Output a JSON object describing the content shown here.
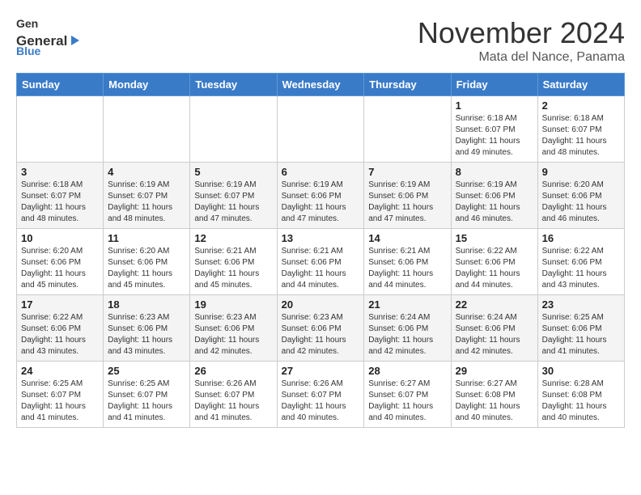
{
  "logo": {
    "text_general": "General",
    "text_blue": "Blue"
  },
  "header": {
    "month": "November 2024",
    "location": "Mata del Nance, Panama"
  },
  "weekdays": [
    "Sunday",
    "Monday",
    "Tuesday",
    "Wednesday",
    "Thursday",
    "Friday",
    "Saturday"
  ],
  "weeks": [
    [
      {
        "day": "",
        "info": ""
      },
      {
        "day": "",
        "info": ""
      },
      {
        "day": "",
        "info": ""
      },
      {
        "day": "",
        "info": ""
      },
      {
        "day": "",
        "info": ""
      },
      {
        "day": "1",
        "info": "Sunrise: 6:18 AM\nSunset: 6:07 PM\nDaylight: 11 hours and 49 minutes."
      },
      {
        "day": "2",
        "info": "Sunrise: 6:18 AM\nSunset: 6:07 PM\nDaylight: 11 hours and 48 minutes."
      }
    ],
    [
      {
        "day": "3",
        "info": "Sunrise: 6:18 AM\nSunset: 6:07 PM\nDaylight: 11 hours and 48 minutes."
      },
      {
        "day": "4",
        "info": "Sunrise: 6:19 AM\nSunset: 6:07 PM\nDaylight: 11 hours and 48 minutes."
      },
      {
        "day": "5",
        "info": "Sunrise: 6:19 AM\nSunset: 6:07 PM\nDaylight: 11 hours and 47 minutes."
      },
      {
        "day": "6",
        "info": "Sunrise: 6:19 AM\nSunset: 6:06 PM\nDaylight: 11 hours and 47 minutes."
      },
      {
        "day": "7",
        "info": "Sunrise: 6:19 AM\nSunset: 6:06 PM\nDaylight: 11 hours and 47 minutes."
      },
      {
        "day": "8",
        "info": "Sunrise: 6:19 AM\nSunset: 6:06 PM\nDaylight: 11 hours and 46 minutes."
      },
      {
        "day": "9",
        "info": "Sunrise: 6:20 AM\nSunset: 6:06 PM\nDaylight: 11 hours and 46 minutes."
      }
    ],
    [
      {
        "day": "10",
        "info": "Sunrise: 6:20 AM\nSunset: 6:06 PM\nDaylight: 11 hours and 45 minutes."
      },
      {
        "day": "11",
        "info": "Sunrise: 6:20 AM\nSunset: 6:06 PM\nDaylight: 11 hours and 45 minutes."
      },
      {
        "day": "12",
        "info": "Sunrise: 6:21 AM\nSunset: 6:06 PM\nDaylight: 11 hours and 45 minutes."
      },
      {
        "day": "13",
        "info": "Sunrise: 6:21 AM\nSunset: 6:06 PM\nDaylight: 11 hours and 44 minutes."
      },
      {
        "day": "14",
        "info": "Sunrise: 6:21 AM\nSunset: 6:06 PM\nDaylight: 11 hours and 44 minutes."
      },
      {
        "day": "15",
        "info": "Sunrise: 6:22 AM\nSunset: 6:06 PM\nDaylight: 11 hours and 44 minutes."
      },
      {
        "day": "16",
        "info": "Sunrise: 6:22 AM\nSunset: 6:06 PM\nDaylight: 11 hours and 43 minutes."
      }
    ],
    [
      {
        "day": "17",
        "info": "Sunrise: 6:22 AM\nSunset: 6:06 PM\nDaylight: 11 hours and 43 minutes."
      },
      {
        "day": "18",
        "info": "Sunrise: 6:23 AM\nSunset: 6:06 PM\nDaylight: 11 hours and 43 minutes."
      },
      {
        "day": "19",
        "info": "Sunrise: 6:23 AM\nSunset: 6:06 PM\nDaylight: 11 hours and 42 minutes."
      },
      {
        "day": "20",
        "info": "Sunrise: 6:23 AM\nSunset: 6:06 PM\nDaylight: 11 hours and 42 minutes."
      },
      {
        "day": "21",
        "info": "Sunrise: 6:24 AM\nSunset: 6:06 PM\nDaylight: 11 hours and 42 minutes."
      },
      {
        "day": "22",
        "info": "Sunrise: 6:24 AM\nSunset: 6:06 PM\nDaylight: 11 hours and 42 minutes."
      },
      {
        "day": "23",
        "info": "Sunrise: 6:25 AM\nSunset: 6:06 PM\nDaylight: 11 hours and 41 minutes."
      }
    ],
    [
      {
        "day": "24",
        "info": "Sunrise: 6:25 AM\nSunset: 6:07 PM\nDaylight: 11 hours and 41 minutes."
      },
      {
        "day": "25",
        "info": "Sunrise: 6:25 AM\nSunset: 6:07 PM\nDaylight: 11 hours and 41 minutes."
      },
      {
        "day": "26",
        "info": "Sunrise: 6:26 AM\nSunset: 6:07 PM\nDaylight: 11 hours and 41 minutes."
      },
      {
        "day": "27",
        "info": "Sunrise: 6:26 AM\nSunset: 6:07 PM\nDaylight: 11 hours and 40 minutes."
      },
      {
        "day": "28",
        "info": "Sunrise: 6:27 AM\nSunset: 6:07 PM\nDaylight: 11 hours and 40 minutes."
      },
      {
        "day": "29",
        "info": "Sunrise: 6:27 AM\nSunset: 6:08 PM\nDaylight: 11 hours and 40 minutes."
      },
      {
        "day": "30",
        "info": "Sunrise: 6:28 AM\nSunset: 6:08 PM\nDaylight: 11 hours and 40 minutes."
      }
    ]
  ]
}
